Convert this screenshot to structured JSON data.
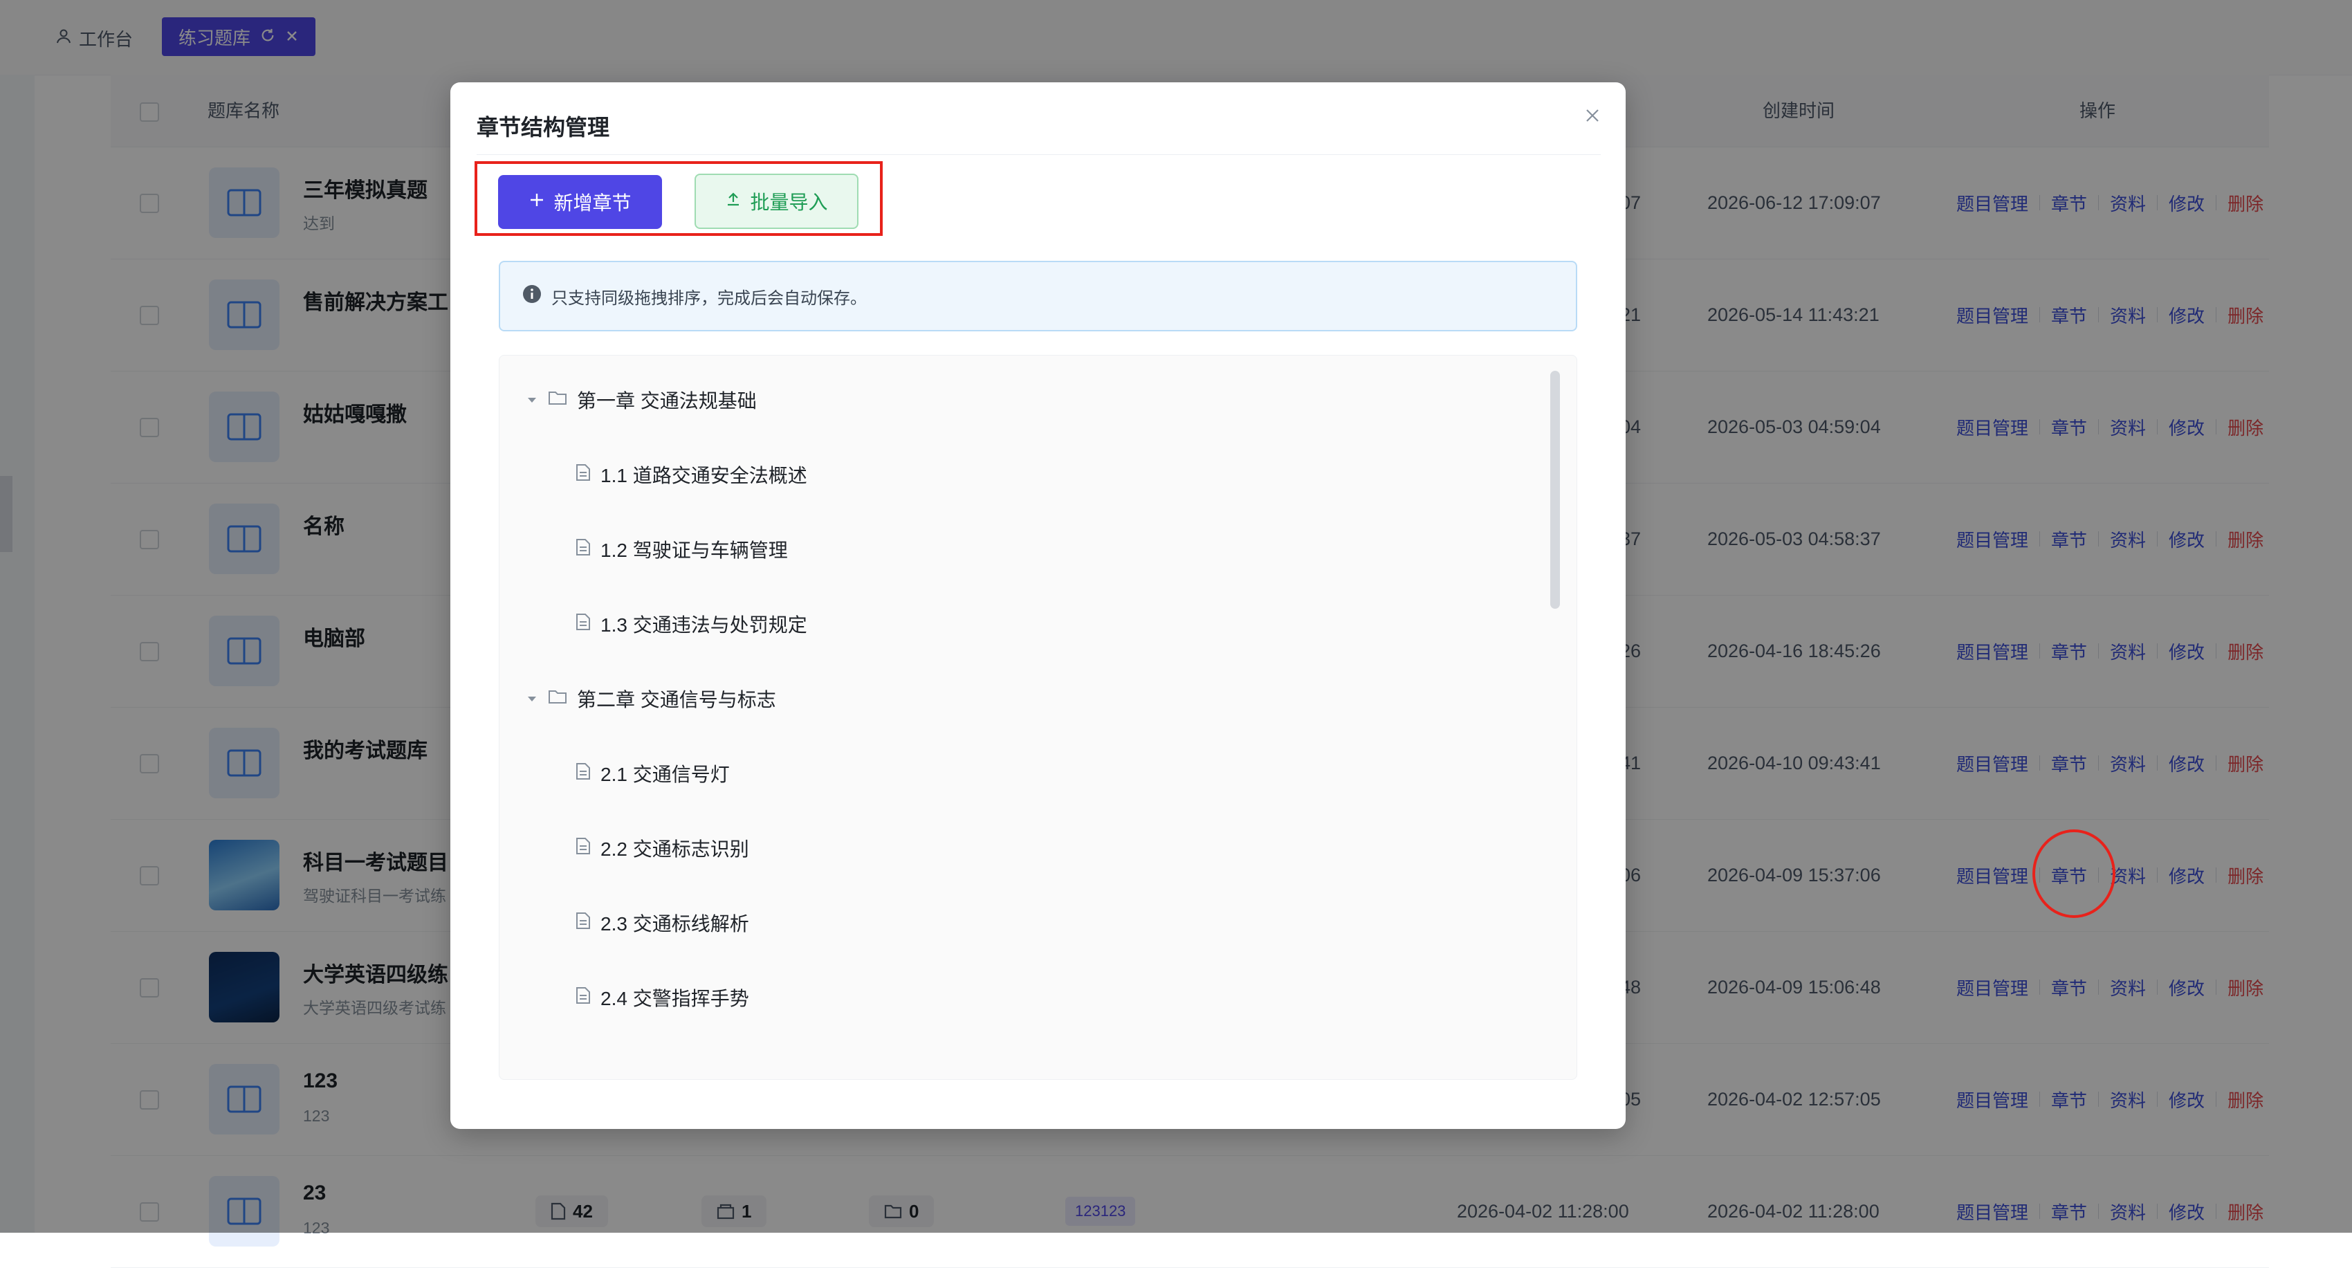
{
  "tabs": {
    "home_label": "工作台",
    "active_label": "练习题库"
  },
  "table": {
    "headers": {
      "name": "题库名称",
      "created": "创建时间",
      "ops": "操作"
    },
    "ops_labels": {
      "questions": "题目管理",
      "chapters": "章节",
      "materials": "资料",
      "edit": "修改",
      "delete": "删除"
    },
    "rows": [
      {
        "name": "三年模拟真题",
        "subtitle": "达到",
        "time_partial": "07",
        "created": "2026-06-12 17:09:07"
      },
      {
        "name": "售前解决方案工",
        "subtitle": "",
        "time_partial": "21",
        "created": "2026-05-14 11:43:21"
      },
      {
        "name": "姑姑嘎嘎撒",
        "subtitle": "",
        "time_partial": "04",
        "created": "2026-05-03 04:59:04"
      },
      {
        "name": "名称",
        "subtitle": "",
        "time_partial": "37",
        "created": "2026-05-03 04:58:37"
      },
      {
        "name": "电脑部",
        "subtitle": "",
        "time_partial": "26",
        "created": "2026-04-16 18:45:26"
      },
      {
        "name": "我的考试题库",
        "subtitle": "",
        "time_partial": "41",
        "created": "2026-04-10 09:43:41"
      },
      {
        "name": "科目一考试题目",
        "subtitle": "驾驶证科目一考试练",
        "time_partial": "06",
        "created": "2026-04-09 15:37:06"
      },
      {
        "name": "大学英语四级练",
        "subtitle": "大学英语四级考试练",
        "time_partial": "48",
        "created": "2026-04-09 15:06:48"
      },
      {
        "name": "123",
        "subtitle": "123",
        "time_partial": "05",
        "created": "2026-04-02 12:57:05"
      },
      {
        "name": "23",
        "subtitle": "123",
        "time_partial": "",
        "created": "2026-04-02 11:28:00"
      }
    ],
    "last_row_extra": {
      "count_questions": "42",
      "count_papers": "1",
      "count_folders": "0",
      "tag": "123123",
      "updated": "2026-04-02 11:28:00"
    }
  },
  "modal": {
    "title": "章节结构管理",
    "add_button": "新增章节",
    "import_button": "批量导入",
    "notice": "只支持同级拖拽排序，完成后会自动保存。",
    "tree": [
      {
        "label": "第一章 交通法规基础",
        "level": 0
      },
      {
        "label": "1.1 道路交通安全法概述",
        "level": 1
      },
      {
        "label": "1.2 驾驶证与车辆管理",
        "level": 1
      },
      {
        "label": "1.3 交通违法与处罚规定",
        "level": 1
      },
      {
        "label": "第二章 交通信号与标志",
        "level": 0
      },
      {
        "label": "2.1 交通信号灯",
        "level": 1
      },
      {
        "label": "2.2 交通标志识别",
        "level": 1
      },
      {
        "label": "2.3 交通标线解析",
        "level": 1
      },
      {
        "label": "2.4 交警指挥手势",
        "level": 1
      }
    ]
  },
  "colors": {
    "primary": "#4f46e5",
    "link": "#3c4fd8",
    "danger": "#e5484d",
    "success": "#1f9d55",
    "annotation_red": "#e8221b"
  }
}
